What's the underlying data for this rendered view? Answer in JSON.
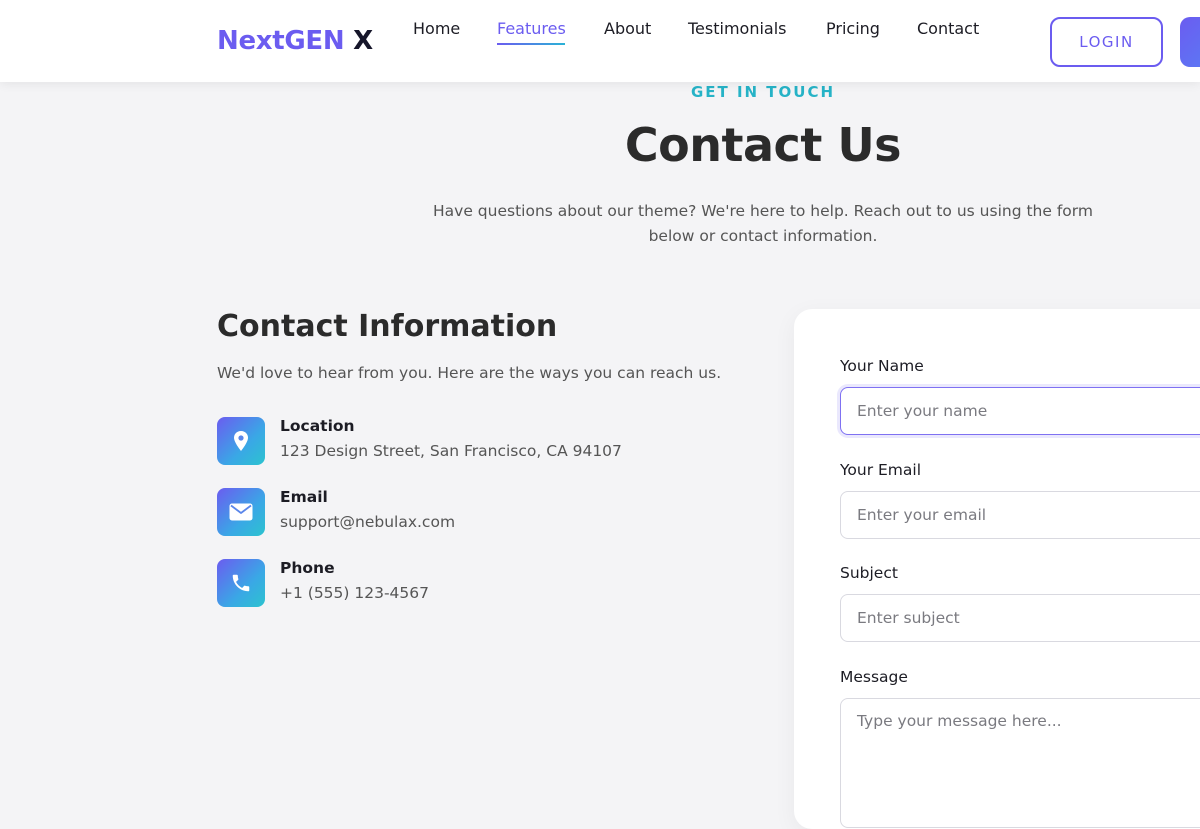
{
  "header": {
    "logo_brand": "NextGEN",
    "logo_suffix": "X",
    "nav": [
      {
        "label": "Home"
      },
      {
        "label": "Features",
        "active": true
      },
      {
        "label": "About"
      },
      {
        "label": "Testimonials"
      },
      {
        "label": "Pricing"
      },
      {
        "label": "Contact"
      }
    ],
    "login_label": "LOGIN"
  },
  "hero": {
    "eyebrow": "GET IN TOUCH",
    "title": "Contact Us",
    "lead": "Have questions about our theme? We're here to help. Reach out to us using the form below or contact information."
  },
  "contact_info": {
    "title": "Contact Information",
    "intro": "We'd love to hear from you. Here are the ways you can reach us.",
    "items": [
      {
        "icon": "location-pin-icon",
        "label": "Location",
        "value": "123 Design Street, San Francisco, CA 94107"
      },
      {
        "icon": "envelope-icon",
        "label": "Email",
        "value": "support@nebulax.com"
      },
      {
        "icon": "phone-icon",
        "label": "Phone",
        "value": "+1 (555) 123-4567"
      }
    ]
  },
  "form": {
    "name_label": "Your Name",
    "name_placeholder": "Enter your name",
    "email_label": "Your Email",
    "email_placeholder": "Enter your email",
    "subject_label": "Subject",
    "subject_placeholder": "Enter subject",
    "message_label": "Message",
    "message_placeholder": "Type your message here..."
  },
  "colors": {
    "accent": "#6b5cf0",
    "teal": "#26b3c7",
    "background": "#f4f4f6"
  }
}
